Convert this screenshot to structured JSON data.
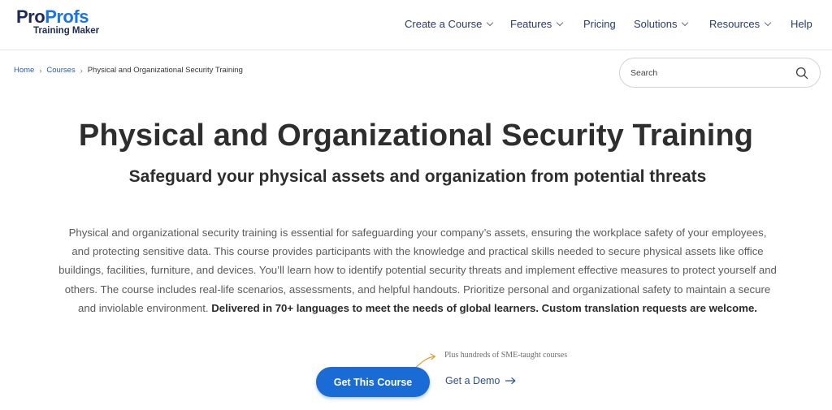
{
  "logo": {
    "pro": "Pro",
    "profs": "Profs",
    "sub": "Training Maker"
  },
  "nav": [
    {
      "label": "Create a Course",
      "has_dropdown": true
    },
    {
      "label": "Features",
      "has_dropdown": true
    },
    {
      "label": "Pricing",
      "has_dropdown": false
    },
    {
      "label": "Solutions",
      "has_dropdown": true
    },
    {
      "label": "Resources",
      "has_dropdown": true
    },
    {
      "label": "Help",
      "has_dropdown": false
    }
  ],
  "breadcrumb": {
    "home": "Home",
    "courses": "Courses",
    "separator": "›",
    "current": "Physical and Organizational Security Training"
  },
  "search": {
    "placeholder": "Search",
    "value": ""
  },
  "hero": {
    "title": "Physical and Organizational Security Training",
    "subtitle": "Safeguard your physical assets and organization from potential threats",
    "description": "Physical and organizational security training is essential for safeguarding your company’s assets, ensuring the workplace safety of your employees, and protecting sensitive data. This course provides participants with the knowledge and practical skills needed to secure physical assets like office buildings, facilities, furniture, and devices. You’ll learn how to identify potential security threats and implement effective measures to protect yourself and others. The course includes real-life scenarios, assessments, and helpful handouts. Prioritize personal and organizational safety to maintain a secure and inviolable environment.",
    "description_bold": "Delivered in 70+ languages to meet the needs of global learners. Custom translation requests are welcome."
  },
  "note": "Plus hundreds of SME-taught courses",
  "cta": {
    "primary": "Get This Course",
    "secondary": "Get a Demo"
  },
  "colors": {
    "brand_blue": "#1a6bd6",
    "nav_text": "#2b3a67",
    "logo_navy": "#1e2a55"
  },
  "icons": {
    "search": "search-icon",
    "dropdown": "chevron-down-icon",
    "arrow": "arrow-right-icon",
    "curved_arrow": "curved-arrow-icon"
  }
}
